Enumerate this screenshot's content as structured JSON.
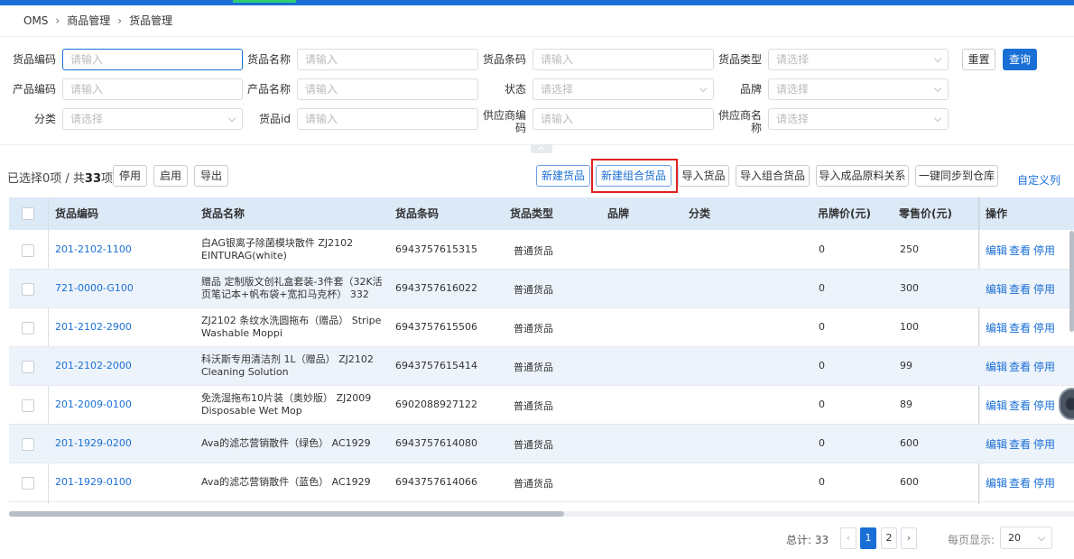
{
  "breadcrumb": [
    "OMS",
    "商品管理",
    "货品管理"
  ],
  "filters": {
    "goods_code": {
      "label": "货品编码",
      "placeholder": "请输入"
    },
    "goods_name": {
      "label": "货品名称",
      "placeholder": "请输入"
    },
    "goods_barcode": {
      "label": "货品条码",
      "placeholder": "请输入"
    },
    "goods_type": {
      "label": "货品类型",
      "placeholder": "请选择"
    },
    "product_code": {
      "label": "产品编码",
      "placeholder": "请输入"
    },
    "product_name": {
      "label": "产品名称",
      "placeholder": "请输入"
    },
    "status": {
      "label": "状态",
      "placeholder": "请选择"
    },
    "brand": {
      "label": "品牌",
      "placeholder": "请选择"
    },
    "category": {
      "label": "分类",
      "placeholder": "请选择"
    },
    "goods_id": {
      "label": "货品id",
      "placeholder": "请输入"
    },
    "supplier_code": {
      "label": "供应商编码",
      "placeholder": "请输入"
    },
    "supplier_name": {
      "label": "供应商名称",
      "placeholder": "请选择"
    }
  },
  "buttons": {
    "reset": "重置",
    "search": "查询",
    "disable": "停用",
    "enable": "启用",
    "export": "导出",
    "new_goods": "新建货品",
    "new_combo": "新建组合货品",
    "import_goods": "导入货品",
    "import_combo": "导入组合货品",
    "import_bom": "导入成品原料关系",
    "sync_warehouse": "一键同步到仓库",
    "custom_columns": "自定义列"
  },
  "selection": {
    "prefix": "已选择0项 / 共",
    "count": "33",
    "suffix": "项"
  },
  "table": {
    "headers": {
      "code": "货品编码",
      "name": "货品名称",
      "barcode": "货品条码",
      "type": "货品类型",
      "brand": "品牌",
      "category": "分类",
      "tag_price": "吊牌价(元)",
      "retail_price": "零售价(元)",
      "ops": "操作"
    },
    "actions": [
      "编辑",
      "查看",
      "停用"
    ],
    "rows": [
      {
        "code": "201-2102-1100",
        "name": "白AG银离子除菌模块散件 ZJ2102 EINTURAG(white)",
        "barcode": "6943757615315",
        "type": "普通货品",
        "tag_price": "0",
        "retail_price": "250"
      },
      {
        "code": "721-0000-G100",
        "name": "赠品 定制版文创礼盒套装-3件套（32K活页笔记本+帆布袋+宽扣马克杯） 332",
        "barcode": "6943757616022",
        "type": "普通货品",
        "tag_price": "0",
        "retail_price": "300"
      },
      {
        "code": "201-2102-2900",
        "name": "ZJ2102 条纹水洗圆拖布（赠品） Stripe Washable Moppi",
        "barcode": "6943757615506",
        "type": "普通货品",
        "tag_price": "0",
        "retail_price": "100"
      },
      {
        "code": "201-2102-2000",
        "name": "科沃斯专用清洁剂 1L（赠品） ZJ2102 Cleaning Solution",
        "barcode": "6943757615414",
        "type": "普通货品",
        "tag_price": "0",
        "retail_price": "99"
      },
      {
        "code": "201-2009-0100",
        "name": "免洗湿拖布10片装（奥妙版） ZJ2009 Disposable Wet Mop",
        "barcode": "6902088927122",
        "type": "普通货品",
        "tag_price": "0",
        "retail_price": "89"
      },
      {
        "code": "201-1929-0200",
        "name": "Ava的滤芯营销散件（绿色） AC1929",
        "barcode": "6943757614080",
        "type": "普通货品",
        "tag_price": "0",
        "retail_price": "600"
      },
      {
        "code": "201-1929-0100",
        "name": "Ava的滤芯营销散件（蓝色） AC1929",
        "barcode": "6943757614066",
        "type": "普通货品",
        "tag_price": "0",
        "retail_price": "600"
      }
    ]
  },
  "pagination": {
    "total_label": "总计: 33",
    "pages": [
      "1",
      "2"
    ],
    "current": "1",
    "per_page_label": "每页显示:",
    "per_page": "20"
  },
  "colors": {
    "primary": "#1a6fd6",
    "header_bg": "#dce9f7",
    "highlight": "#e02020"
  }
}
